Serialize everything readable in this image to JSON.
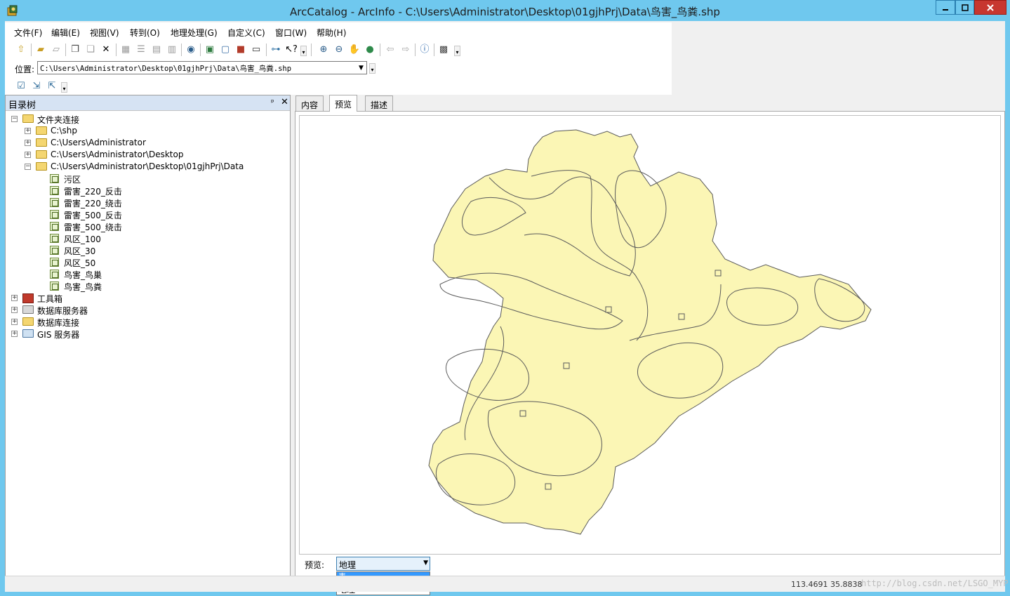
{
  "window": {
    "title": "ArcCatalog - ArcInfo - C:\\Users\\Administrator\\Desktop\\01gjhPrj\\Data\\鸟害_鸟粪.shp"
  },
  "menu": [
    "文件(F)",
    "编辑(E)",
    "视图(V)",
    "转到(O)",
    "地理处理(G)",
    "自定义(C)",
    "窗口(W)",
    "帮助(H)"
  ],
  "location": {
    "label": "位置:",
    "value": "C:\\Users\\Administrator\\Desktop\\01gjhPrj\\Data\\鸟害_鸟粪.shp"
  },
  "catalog": {
    "title": "目录树",
    "root": "文件夹连接",
    "folders": [
      "C:\\shp",
      "C:\\Users\\Administrator",
      "C:\\Users\\Administrator\\Desktop",
      "C:\\Users\\Administrator\\Desktop\\01gjhPrj\\Data"
    ],
    "files": [
      "污区",
      "雷害_220_反击",
      "雷害_220_绕击",
      "雷害_500_反击",
      "雷害_500_绕击",
      "风区_100",
      "风区_30",
      "风区_50",
      "鸟害_鸟巢",
      "鸟害_鸟粪"
    ],
    "others": [
      "工具箱",
      "数据库服务器",
      "数据库连接",
      "GIS 服务器"
    ]
  },
  "tabs": [
    "内容",
    "预览",
    "描述"
  ],
  "preview": {
    "label": "预览:",
    "selected": "地理",
    "options": [
      "表",
      "地理"
    ]
  },
  "status": {
    "coords": "113.4691  35.8838",
    "watermark": "http://blog.csdn.net/LSGO_MYP"
  },
  "colors": {
    "fill": "#fbf6b5",
    "stroke": "#5a5a5a",
    "titlebar": "#6fc8ee"
  }
}
